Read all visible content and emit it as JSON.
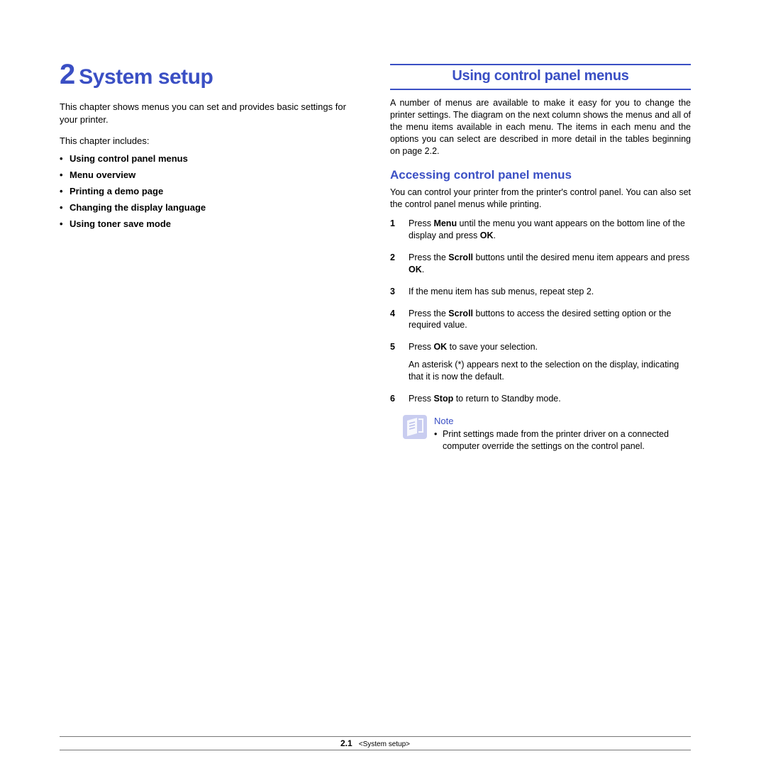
{
  "chapter": {
    "number": "2",
    "title": "System setup"
  },
  "left": {
    "intro": "This chapter shows menus you can set and provides basic settings for your printer.",
    "includes_label": "This chapter includes:",
    "links": [
      "Using control panel menus",
      "Menu overview",
      "Printing a demo page",
      "Changing the display language",
      "Using toner save mode"
    ]
  },
  "right": {
    "section_title": "Using control panel menus",
    "section_intro": "A number of menus are available to make it easy for you to change the printer settings. The diagram on the next column shows the menus and all of the menu items available in each menu. The items in each menu and the options you can select are described in more detail in the tables beginning on page 2.2.",
    "sub_title": "Accessing control panel menus",
    "sub_intro": "You can control your printer from the printer's control panel. You can also set the control panel menus while printing.",
    "steps": [
      {
        "n": "1",
        "pre": "Press ",
        "b1": "Menu",
        "mid": " until the menu you want appears on the bottom line of the display and press ",
        "b2": "OK",
        "post": "."
      },
      {
        "n": "2",
        "pre": "Press the ",
        "b1": "Scroll",
        "mid": " buttons until the desired menu item appears and press ",
        "b2": "OK",
        "post": "."
      },
      {
        "n": "3",
        "plain": "If the menu item has sub menus, repeat step 2."
      },
      {
        "n": "4",
        "pre": "Press the ",
        "b1": "Scroll",
        "mid": " buttons to access the desired setting option or the required value.",
        "b2": "",
        "post": ""
      },
      {
        "n": "5",
        "pre": "Press ",
        "b1": "OK",
        "mid": " to save your selection.",
        "b2": "",
        "post": "",
        "extra": "An asterisk (*) appears next to the selection on the display, indicating that it is now the default."
      },
      {
        "n": "6",
        "pre": "Press ",
        "b1": "Stop",
        "mid": " to return to Standby mode.",
        "b2": "",
        "post": ""
      }
    ],
    "note": {
      "label": "Note",
      "text": "Print settings made from the printer driver on a connected computer override the settings on the control panel."
    }
  },
  "footer": {
    "page": "2.1",
    "crumb": "<System setup>"
  }
}
